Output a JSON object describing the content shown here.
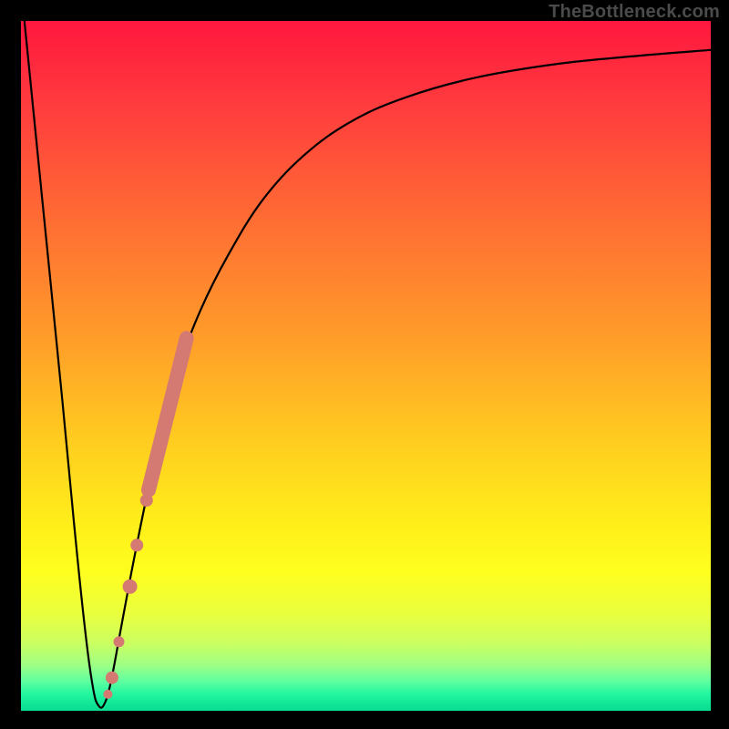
{
  "watermark": "TheBottleneck.com",
  "colors": {
    "frame": "#000000",
    "curve": "#000000",
    "marker": "#d57a72",
    "gradient_stops": [
      {
        "offset": 0.0,
        "color": "#ff173e"
      },
      {
        "offset": 0.12,
        "color": "#ff3b3e"
      },
      {
        "offset": 0.28,
        "color": "#ff6a34"
      },
      {
        "offset": 0.45,
        "color": "#ff9a2a"
      },
      {
        "offset": 0.62,
        "color": "#ffd01f"
      },
      {
        "offset": 0.74,
        "color": "#fff11a"
      },
      {
        "offset": 0.8,
        "color": "#feff1f"
      },
      {
        "offset": 0.86,
        "color": "#e9ff3f"
      },
      {
        "offset": 0.905,
        "color": "#c8ff63"
      },
      {
        "offset": 0.935,
        "color": "#9bff86"
      },
      {
        "offset": 0.958,
        "color": "#5dffa0"
      },
      {
        "offset": 0.975,
        "color": "#25f7a0"
      },
      {
        "offset": 0.992,
        "color": "#0ee495"
      },
      {
        "offset": 1.0,
        "color": "#0bdc91"
      }
    ]
  },
  "chart_data": {
    "type": "line",
    "title": "",
    "xlabel": "",
    "ylabel": "",
    "xlim": [
      0,
      100
    ],
    "ylim": [
      0,
      100
    ],
    "legend": false,
    "grid": false,
    "series": [
      {
        "name": "bottleneck-curve",
        "x": [
          0.5,
          3,
          6,
          8,
          9.5,
          10.5,
          11.2,
          12,
          13,
          14.5,
          16,
          18,
          20,
          23,
          26,
          30,
          35,
          41,
          48,
          56,
          66,
          78,
          90,
          100
        ],
        "y": [
          100,
          75,
          45,
          24,
          10,
          3,
          0.8,
          0.8,
          4,
          12,
          20,
          30,
          39,
          50,
          58,
          66,
          74,
          80.5,
          85.5,
          89,
          91.8,
          93.8,
          95,
          95.8
        ]
      }
    ],
    "markers": [
      {
        "name": "highlight-band-top",
        "x_range": [
          18.5,
          24.0
        ],
        "y_range": [
          32,
          54
        ],
        "style": "thick-line",
        "radius": 8
      },
      {
        "name": "point-a",
        "x": 18.2,
        "y": 30.5,
        "radius": 7
      },
      {
        "name": "point-b",
        "x": 16.8,
        "y": 24.0,
        "radius": 7
      },
      {
        "name": "point-c",
        "x": 15.8,
        "y": 18.0,
        "radius": 8
      },
      {
        "name": "point-d",
        "x": 14.2,
        "y": 10.0,
        "radius": 6
      },
      {
        "name": "point-e",
        "x": 13.2,
        "y": 4.8,
        "radius": 7
      },
      {
        "name": "point-f",
        "x": 12.6,
        "y": 2.4,
        "radius": 5
      }
    ],
    "background": {
      "type": "vertical-gradient",
      "description": "red at top through orange and yellow to green at bottom"
    }
  }
}
